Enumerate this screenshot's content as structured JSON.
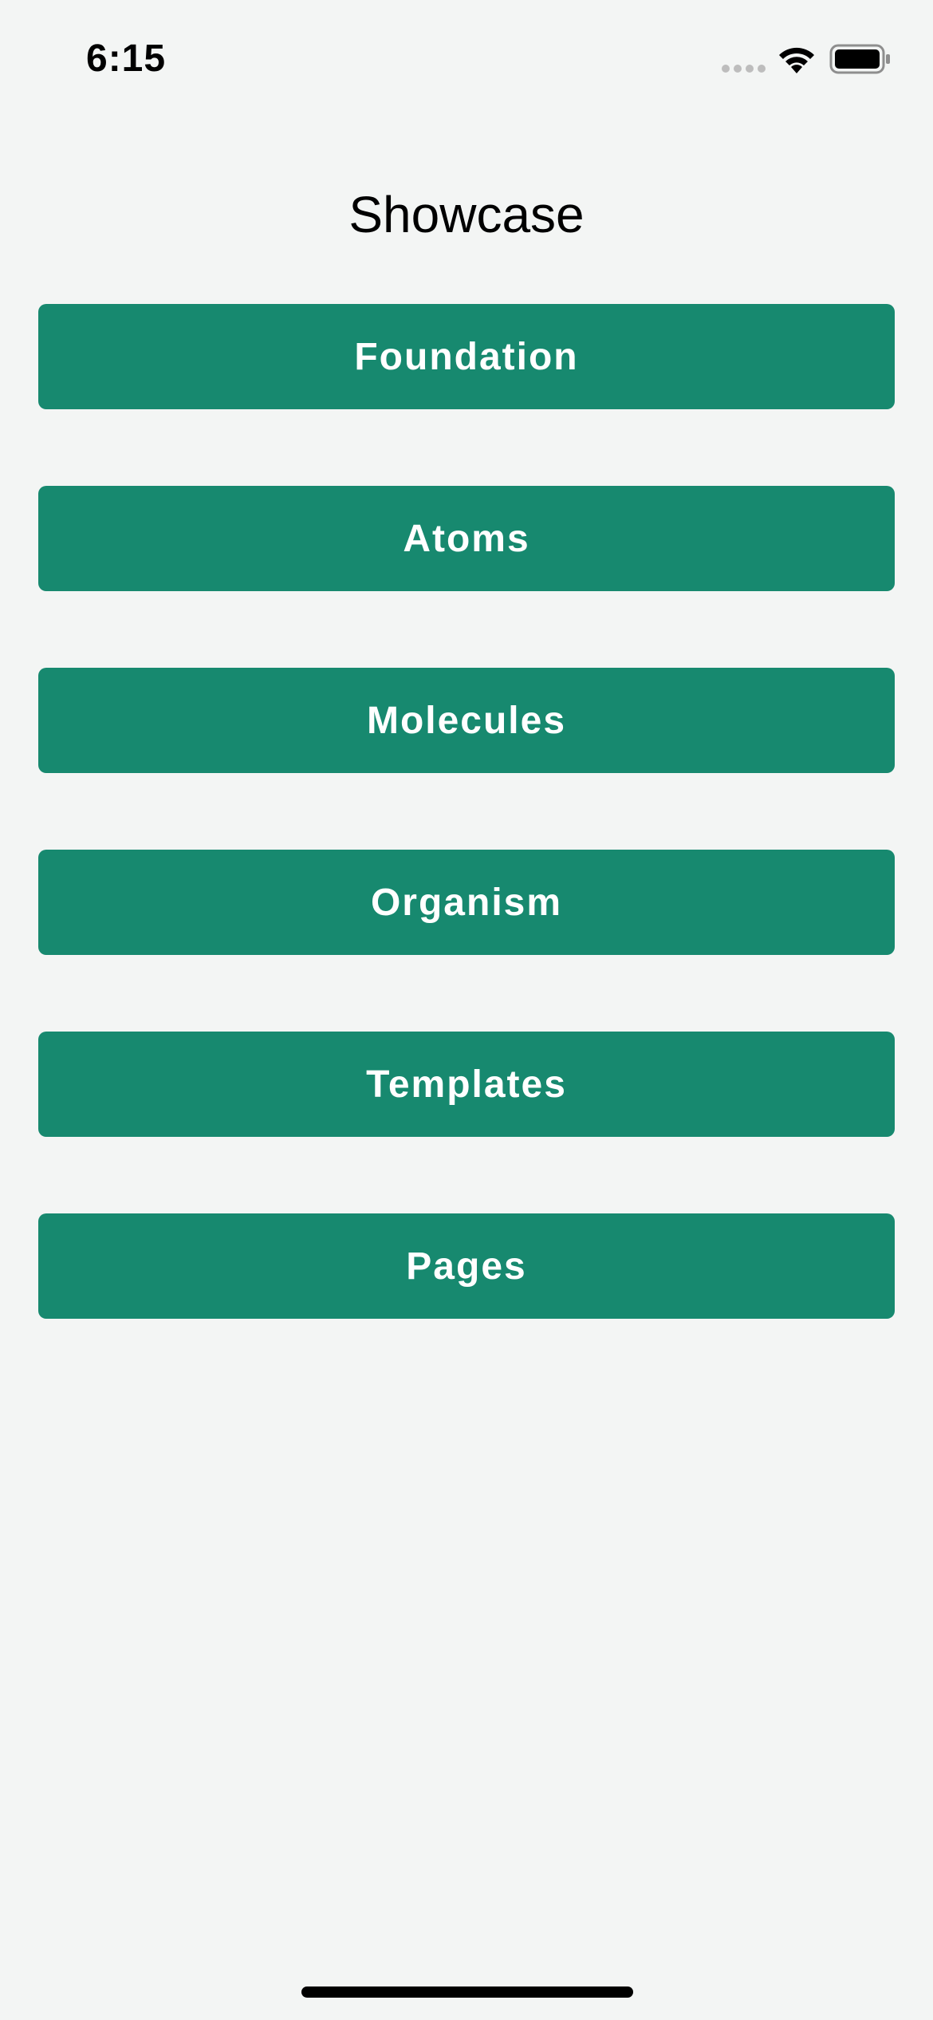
{
  "status_bar": {
    "time": "6:15",
    "icons": [
      "signal-icon",
      "wifi-icon",
      "battery-icon"
    ]
  },
  "nav": {
    "title": "Showcase"
  },
  "menu": {
    "items": [
      {
        "label": "Foundation"
      },
      {
        "label": "Atoms"
      },
      {
        "label": "Molecules"
      },
      {
        "label": "Organism"
      },
      {
        "label": "Templates"
      },
      {
        "label": "Pages"
      }
    ]
  },
  "colors": {
    "background": "#F3F5F4",
    "button_background": "#17896F",
    "button_text": "#FFFFFF",
    "text": "#000000",
    "signal_inactive": "#BDBDBD"
  }
}
